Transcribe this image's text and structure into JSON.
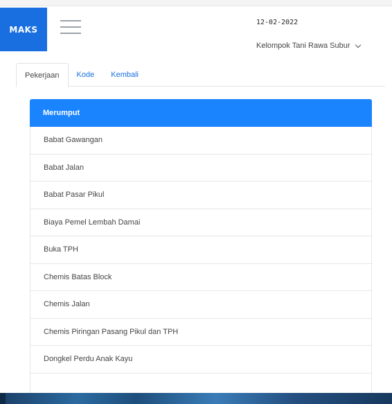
{
  "app": {
    "brand": "MAKS"
  },
  "header": {
    "date": "12-02-2022",
    "user": "Kelompok Tani Rawa Subur"
  },
  "tabs": [
    {
      "label": "Pekerjaan",
      "active": true
    },
    {
      "label": "Kode",
      "active": false
    },
    {
      "label": "Kembali",
      "active": false
    }
  ],
  "list": {
    "header": "Merumput",
    "items": [
      "Babat Gawangan",
      "Babat Jalan",
      "Babat Pasar Pikul",
      "Biaya Pemel Lembah Damai",
      "Buka TPH",
      "Chemis Batas Block",
      "Chemis Jalan",
      "Chemis Piringan Pasang Pikul dan TPH",
      "Dongkel Perdu Anak Kayu",
      ""
    ]
  },
  "colors": {
    "brand": "#1a6fe0",
    "list_header": "#1a84ff",
    "tab_link": "#1a6fe0"
  },
  "icons": {
    "menu": "hamburger-icon",
    "user_dropdown": "chevron-down-icon"
  }
}
